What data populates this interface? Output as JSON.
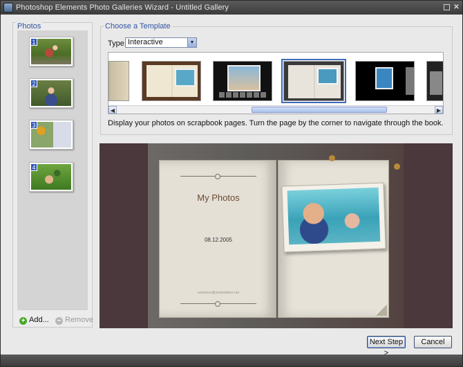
{
  "window": {
    "title": "Photoshop Elements Photo Galleries Wizard - Untitled Gallery",
    "maximize_icon": "maximize-icon",
    "close_icon": "close-icon"
  },
  "photos": {
    "label": "Photos",
    "items": [
      {
        "number": "1",
        "subject": "child in red toy car"
      },
      {
        "number": "2",
        "subject": "boy sitting on grass"
      },
      {
        "number": "3",
        "subject": "boy waving near sign"
      },
      {
        "number": "4",
        "subject": "child lying in grass"
      }
    ],
    "add_label": "Add...",
    "remove_label": "Remove"
  },
  "template": {
    "group_label": "Choose a Template",
    "type_label": "Type:",
    "type_value": "Interactive",
    "selected_index": 3,
    "description": "Display your photos on scrapbook pages. Turn the page by the corner to navigate through the book."
  },
  "preview": {
    "book_title": "My Photos",
    "book_date": "08.12.2005",
    "book_credit": "someone@somewhere.net"
  },
  "buttons": {
    "next": "Next Step >",
    "cancel": "Cancel"
  },
  "colors": {
    "accent": "#2e56b8",
    "preview_bg": "#4a383c",
    "title_text": "#6b4a32"
  }
}
